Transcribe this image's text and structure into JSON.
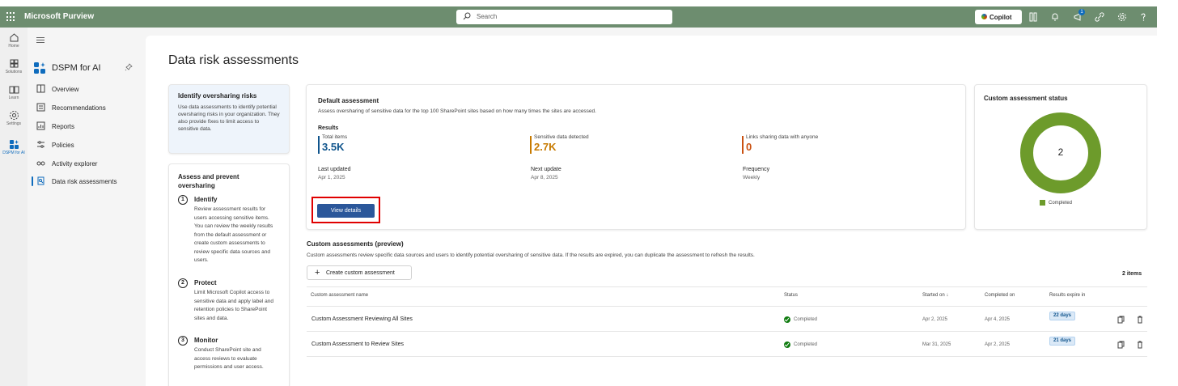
{
  "app": {
    "title": "Microsoft Purview"
  },
  "search": {
    "placeholder": "Search"
  },
  "topbar": {
    "copilot_label": "Copilot",
    "notification_count": "1"
  },
  "rail": [
    {
      "label": "Home",
      "icon": "home-icon"
    },
    {
      "label": "Solutions",
      "icon": "solutions-icon"
    },
    {
      "label": "Learn",
      "icon": "learn-icon"
    },
    {
      "label": "Settings",
      "icon": "settings-icon"
    },
    {
      "label": "DSPM for AI",
      "icon": "dspm-icon"
    }
  ],
  "nav": {
    "title": "DSPM for AI",
    "items": [
      {
        "label": "Overview",
        "icon": "overview-icon"
      },
      {
        "label": "Recommendations",
        "icon": "recommendations-icon"
      },
      {
        "label": "Reports",
        "icon": "reports-icon"
      },
      {
        "label": "Policies",
        "icon": "policies-icon"
      },
      {
        "label": "Activity explorer",
        "icon": "glasses-icon"
      },
      {
        "label": "Data risk assessments",
        "icon": "data-risk-icon",
        "active": true
      }
    ]
  },
  "page": {
    "title": "Data risk assessments"
  },
  "identify_card": {
    "title": "Identify oversharing risks",
    "description": "Use data assessments to identify potential oversharing risks in your organization. They also provide fixes to limit access to sensitive data."
  },
  "assess_card": {
    "title": "Assess and prevent oversharing",
    "steps": [
      {
        "num": "1",
        "title": "Identify",
        "desc": "Review assessment results for users accessing sensitive items. You can review the weekly results from the default assessment or create custom assessments to review specific data sources and users."
      },
      {
        "num": "2",
        "title": "Protect",
        "desc": "Limit Microsoft Copilot access to sensitive data and apply label and retention policies to SharePoint sites and data."
      },
      {
        "num": "3",
        "title": "Monitor",
        "desc": "Conduct SharePoint site and access reviews to evaluate permissions and user access."
      }
    ]
  },
  "default_assessment": {
    "title": "Default assessment",
    "description": "Assess oversharing of sensitive data for the top 100 SharePoint sites based on how many times the sites are accessed.",
    "results_label": "Results",
    "metrics": [
      {
        "label": "Total items",
        "value": "3.5K",
        "color": "#0f548c"
      },
      {
        "label": "Sensitive data detected",
        "value": "2.7K",
        "color": "#c77a00"
      },
      {
        "label": "Links sharing data with anyone",
        "value": "0",
        "color": "#ca5010"
      }
    ],
    "info": [
      {
        "label": "Last updated",
        "value": "Apr 1, 2025"
      },
      {
        "label": "Next update",
        "value": "Apr 8, 2025"
      },
      {
        "label": "Frequency",
        "value": "Weekly"
      }
    ],
    "button_label": "View details"
  },
  "custom_status": {
    "title": "Custom assessment status",
    "count": "2",
    "legend": "Completed",
    "color": "#6d9b2b",
    "completed_fraction": 1.0
  },
  "custom_assessments": {
    "title": "Custom assessments (preview)",
    "description": "Custom assessments review specific data sources and users to identify potential oversharing of sensitive data. If the results are expired, you can duplicate the assessment to refresh the results.",
    "create_label": "Create custom assessment",
    "items_count": "2 items",
    "columns": [
      "Custom assessment name",
      "Status",
      "Started on ↓",
      "Completed on",
      "Results expire in"
    ],
    "rows": [
      {
        "name": "Custom Assessment Reviewing All Sites",
        "status": "Completed",
        "started": "Apr 2, 2025",
        "completed": "Apr 4, 2025",
        "expires": "22 days"
      },
      {
        "name": "Custom Assessment to Review Sites",
        "status": "Completed",
        "started": "Mar 31, 2025",
        "completed": "Apr 2, 2025",
        "expires": "21 days"
      }
    ]
  }
}
